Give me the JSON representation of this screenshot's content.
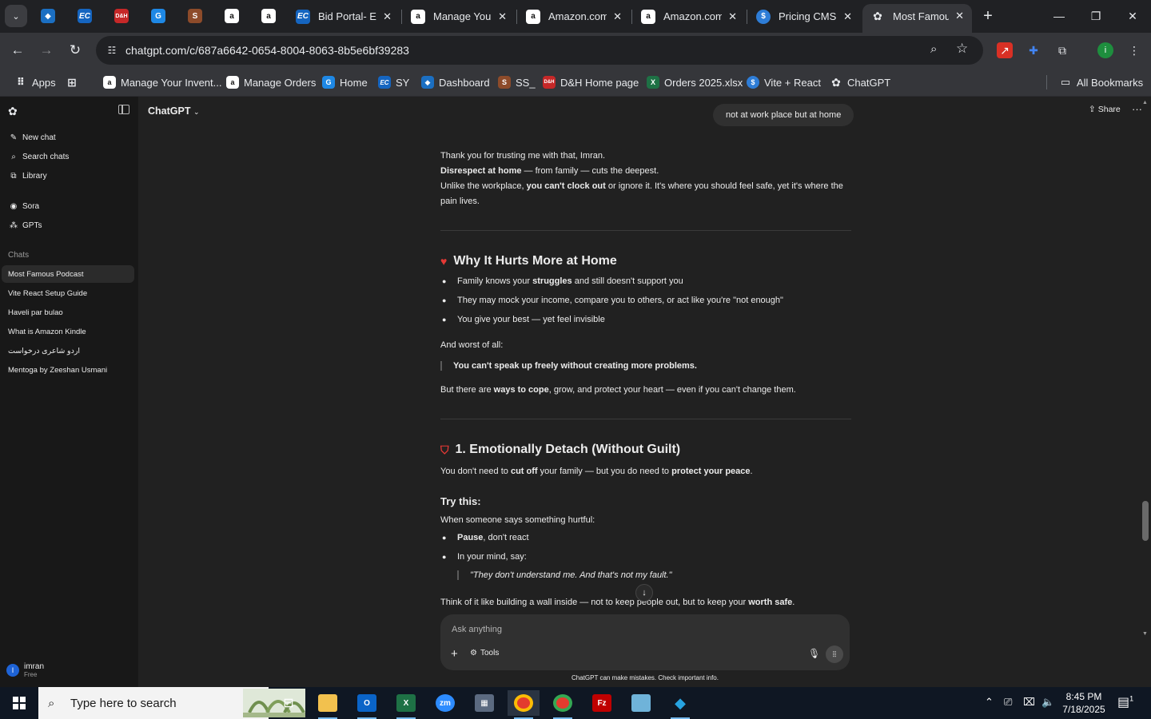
{
  "browser": {
    "tabs": [
      {
        "label": "Bid Portal- EC",
        "icon": "ec-icon"
      },
      {
        "label": "Manage Your",
        "icon": "amazon-icon"
      },
      {
        "label": "Amazon.com",
        "icon": "amazon-icon"
      },
      {
        "label": "Amazon.com",
        "icon": "amazon-icon"
      },
      {
        "label": "Pricing CMS",
        "icon": "dollar-icon"
      },
      {
        "label": "Most Famous",
        "icon": "chatgpt-icon"
      }
    ],
    "url": "chatgpt.com/c/687a6642-0654-8004-8063-8b5e6bf39283",
    "bookmarks": [
      {
        "label": "Apps"
      },
      {
        "label": "Manage Your Invent..."
      },
      {
        "label": "Manage Orders"
      },
      {
        "label": "Home"
      },
      {
        "label": "SY"
      },
      {
        "label": "Dashboard"
      },
      {
        "label": "SS_"
      },
      {
        "label": "D&H Home page"
      },
      {
        "label": "Orders 2025.xlsx"
      },
      {
        "label": "Vite + React"
      },
      {
        "label": "ChatGPT"
      }
    ],
    "all_bookmarks": "All Bookmarks",
    "profile_initial": "i"
  },
  "sidebar": {
    "actions": [
      {
        "label": "New chat",
        "icon": "✎"
      },
      {
        "label": "Search chats",
        "icon": "⌕"
      },
      {
        "label": "Library",
        "icon": "⧉"
      }
    ],
    "apps": [
      {
        "label": "Sora",
        "icon": "◉"
      },
      {
        "label": "GPTs",
        "icon": "⁂"
      }
    ],
    "chats_heading": "Chats",
    "chats": [
      "Most Famous Podcast",
      "Vite React Setup Guide",
      "Haveli par bulao",
      "What is Amazon Kindle",
      "اردو شاعری درخواست",
      "Mentoga by Zeeshan Usmani"
    ],
    "user": {
      "initial": "I",
      "name": "imran",
      "plan": "Free"
    }
  },
  "header": {
    "model": "ChatGPT",
    "share": "Share"
  },
  "conversation": {
    "user_message": "not at work place but at home",
    "intro": [
      "Thank you for trusting me with that, Imran.",
      "Disrespect at home",
      " — from family — cuts the deepest.",
      "Unlike the workplace, ",
      "you can't clock out",
      " or ignore it. It's where you should feel safe, yet it's where the pain lives."
    ],
    "section1_title": "Why It Hurts More at Home",
    "section1_bullets": [
      [
        "Family knows your ",
        "struggles",
        " and still doesn't support you"
      ],
      [
        "They may mock your income, compare you to others, or act like you're \"not enough\""
      ],
      [
        "You give your best — yet feel invisible"
      ]
    ],
    "worst_label": "And worst of all:",
    "worst_quote": "You can't speak up freely without creating more problems.",
    "cope_line": [
      "But there are ",
      "ways to cope",
      ", grow, and protect your heart — even if you can't change them."
    ],
    "section2_title": "1. Emotionally Detach (Without Guilt)",
    "section2_line": [
      "You don't need to ",
      "cut off",
      " your family — but you do need to ",
      "protect your peace",
      "."
    ],
    "try_this": "Try this:",
    "hurtful_line": "When someone says something hurtful:",
    "try_bullets": [
      [
        "Pause",
        ", don't react"
      ],
      [
        "In your mind, say:"
      ]
    ],
    "mind_quote": "\"They don't understand me. And that's not my fault.\"",
    "wall_line": [
      "Think of it like building a wall inside — not to keep people out, but to keep your ",
      "worth safe",
      "."
    ]
  },
  "composer": {
    "placeholder": "Ask anything",
    "tools": "Tools",
    "disclaimer": "ChatGPT can make mistakes. Check important info."
  },
  "taskbar": {
    "search_placeholder": "Type here to search",
    "time": "8:45 PM",
    "date": "7/18/2025",
    "notification_count": "1"
  }
}
